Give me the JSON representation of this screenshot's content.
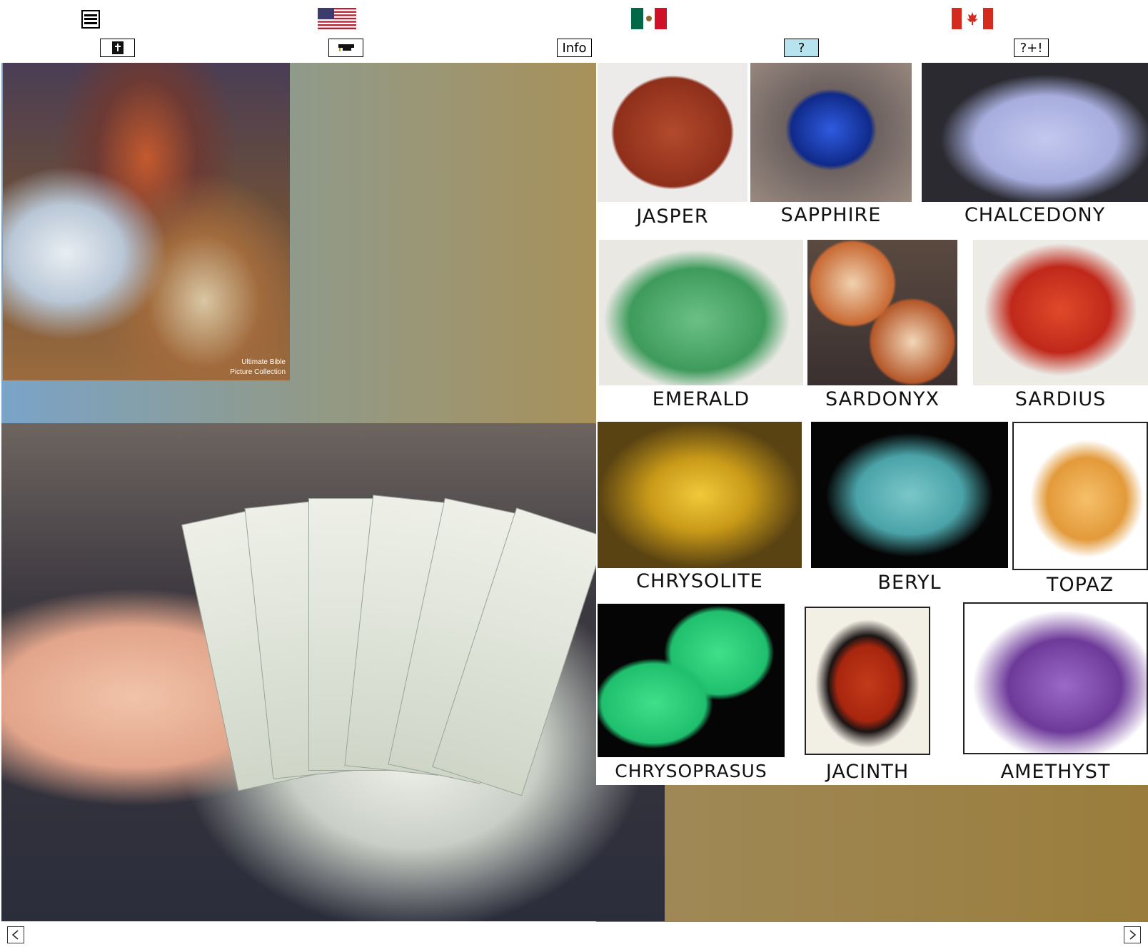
{
  "toolbar": {
    "menu_icon": "hamburger-menu-icon",
    "flags": [
      "us-flag-icon",
      "mexico-flag-icon",
      "canada-flag-icon"
    ],
    "buttons": {
      "bible": "bible-icon",
      "hat": "graduation-cap-icon",
      "info": "Info",
      "question": "?",
      "question_plus": "?+!"
    }
  },
  "jesus_image": {
    "caption_line1": "Ultimate Bible",
    "caption_line2": "Picture Collection"
  },
  "gems": [
    {
      "name": "JASPER",
      "color": "#a63a22"
    },
    {
      "name": "SAPPHIRE",
      "color": "#1a3fb0"
    },
    {
      "name": "CHALCEDONY",
      "color": "#a9b1e0"
    },
    {
      "name": "EMERALD",
      "color": "#3e9b5c"
    },
    {
      "name": "SARDONYX",
      "color": "#c96a34"
    },
    {
      "name": "SARDIUS",
      "color": "#c0281a"
    },
    {
      "name": "CHRYSOLITE",
      "color": "#c99a18"
    },
    {
      "name": "BERYL",
      "color": "#4aa3a8"
    },
    {
      "name": "TOPAZ",
      "color": "#e39a3a"
    },
    {
      "name": "CHRYSOPRASUS",
      "color": "#1fbf6e"
    },
    {
      "name": "JACINTH",
      "color": "#a8260e"
    },
    {
      "name": "AMETHYST",
      "color": "#6e3a9a"
    }
  ],
  "nav": {
    "prev": "chevron-left-icon",
    "next": "chevron-right-icon"
  }
}
